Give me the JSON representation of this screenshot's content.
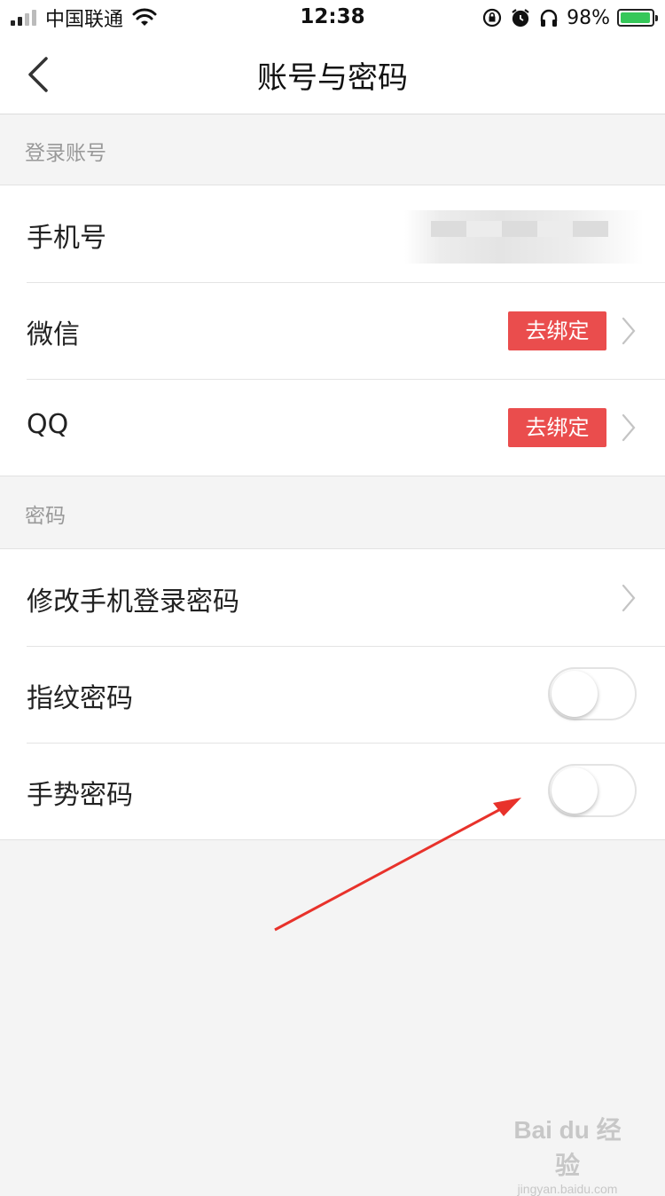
{
  "status_bar": {
    "carrier": "中国联通",
    "time": "12:38",
    "battery_percent": "98%",
    "battery_level": 0.98,
    "icons": [
      "signal-icon",
      "wifi-icon",
      "orientation-lock-icon",
      "alarm-icon",
      "headphones-icon",
      "battery-icon"
    ]
  },
  "nav": {
    "title": "账号与密码",
    "back_icon": "chevron-left-icon"
  },
  "login_section": {
    "header": "登录账号",
    "rows": [
      {
        "label": "手机号",
        "value_state": "blurred"
      },
      {
        "label": "微信",
        "action": "去绑定"
      },
      {
        "label": "QQ",
        "action": "去绑定"
      }
    ]
  },
  "password_section": {
    "header": "密码",
    "rows": [
      {
        "label": "修改手机登录密码"
      },
      {
        "label": "指纹密码",
        "toggle_on": false
      },
      {
        "label": "手势密码",
        "toggle_on": false
      }
    ]
  },
  "colors": {
    "accent_red": "#ea4d4d",
    "annotation_arrow": "#e8322b",
    "battery_green": "#35c759"
  },
  "watermark": {
    "brand": "Bai du 经验",
    "sub": "jingyan.baidu.com"
  }
}
